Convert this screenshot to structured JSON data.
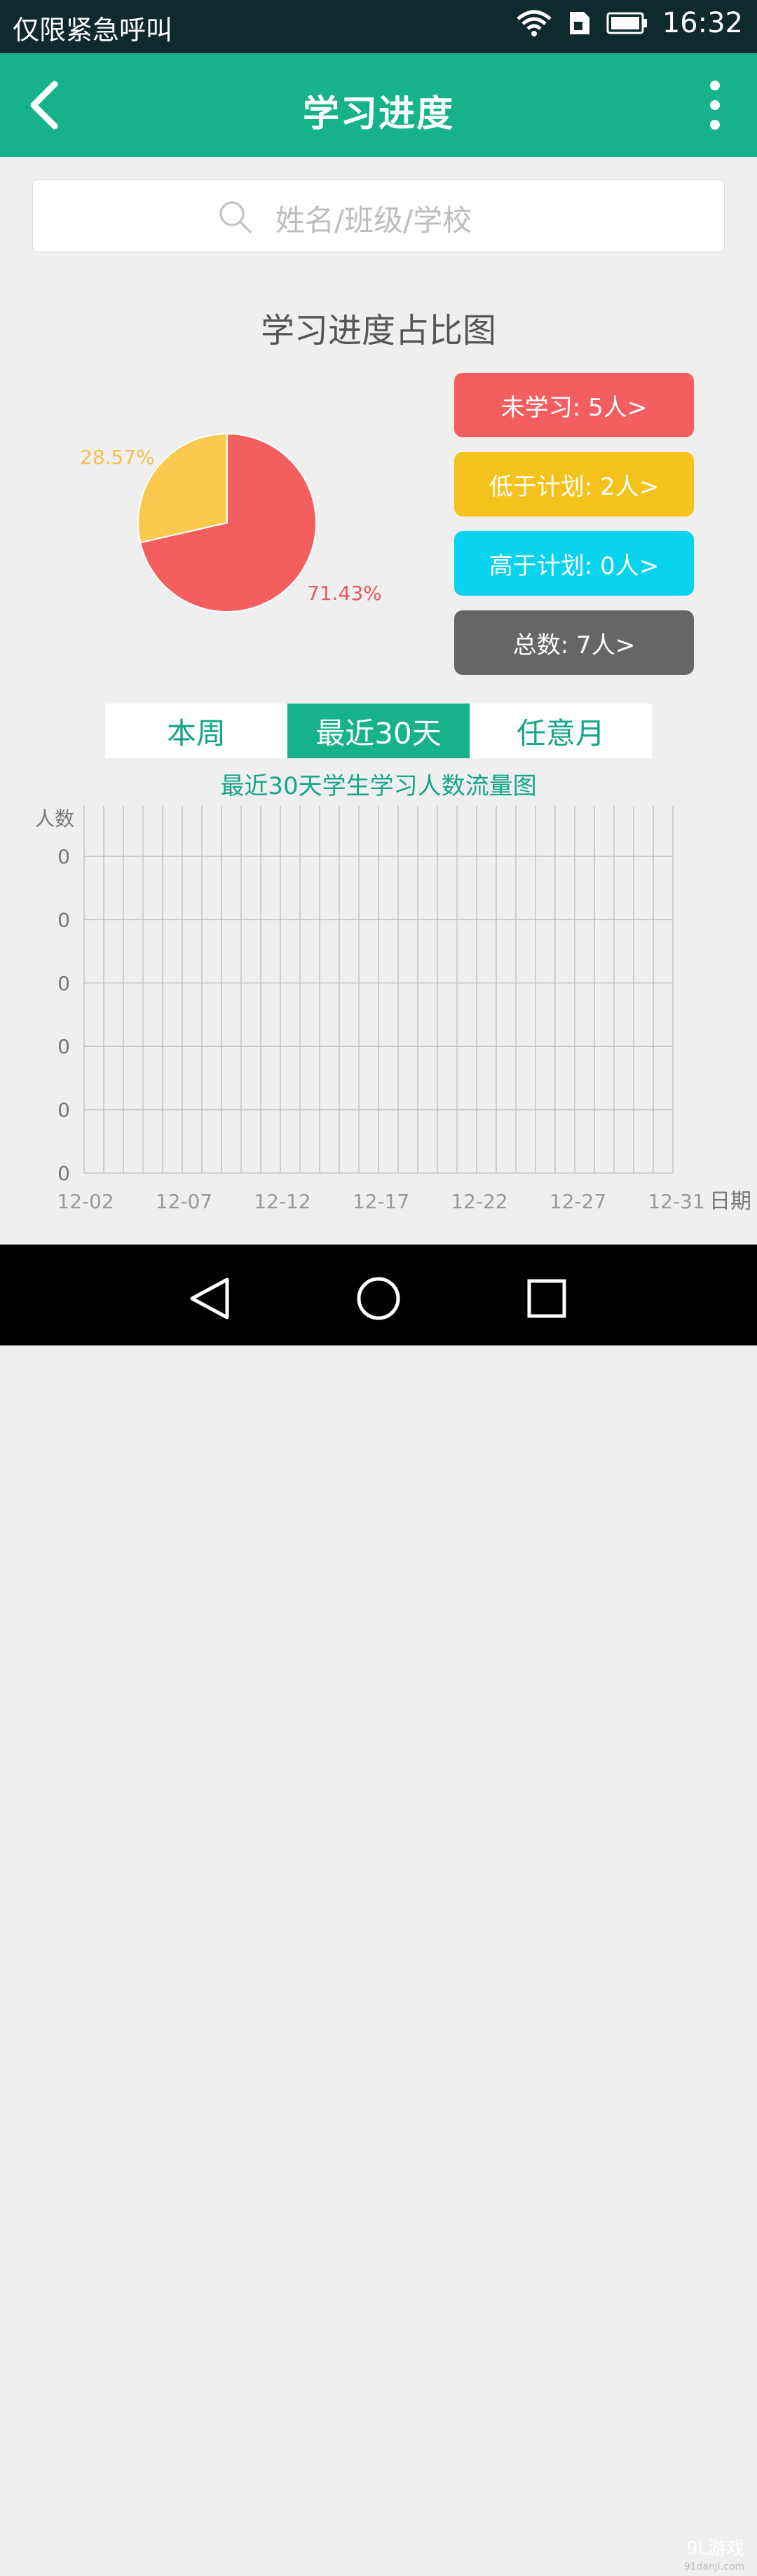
{
  "status_bar": {
    "left_text": "仅限紧急呼叫",
    "time": "16:32"
  },
  "app_bar": {
    "title": "学习进度"
  },
  "search": {
    "placeholder": "姓名/班级/学校"
  },
  "progress_section": {
    "title": "学习进度占比图",
    "legend": [
      {
        "label": "未学习: 5人>",
        "color": "#f45e5e"
      },
      {
        "label": "低于计划: 2人>",
        "color": "#f5c21b"
      },
      {
        "label": "高于计划: 0人>",
        "color": "#08d3ee"
      },
      {
        "label": "总数:  7人>",
        "color": "#666666"
      }
    ]
  },
  "tabs": [
    {
      "label": "本周",
      "active": false
    },
    {
      "label": "最近30天",
      "active": true
    },
    {
      "label": "任意月",
      "active": false
    }
  ],
  "chart_data": [
    {
      "type": "pie",
      "slices": [
        {
          "label": "71.43%",
          "value": 71.43,
          "color": "#f45e5e"
        },
        {
          "label": "28.57%",
          "value": 28.57,
          "color": "#f8c94d"
        }
      ]
    },
    {
      "type": "line",
      "title": "最近30天学生学习人数流量图",
      "xlabel": "日期",
      "ylabel": "人数",
      "x_tick_labels": [
        "12-02",
        "12-07",
        "12-12",
        "12-17",
        "12-22",
        "12-27",
        "12-31"
      ],
      "y_tick_labels": [
        "0",
        "0",
        "0",
        "0",
        "0",
        "0"
      ],
      "x_days": 30,
      "grid": true,
      "series": []
    }
  ],
  "watermark": {
    "brand": "9L游戏",
    "site": "91danji.com"
  }
}
